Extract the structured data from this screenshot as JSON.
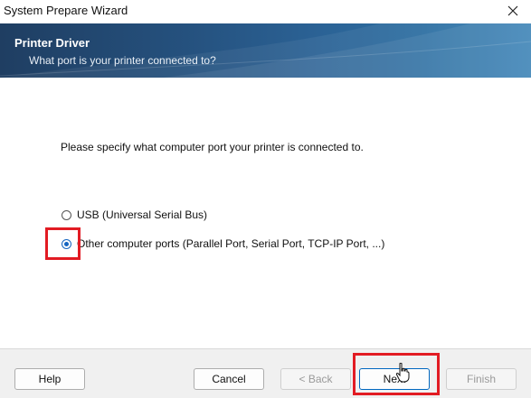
{
  "window": {
    "title": "System Prepare Wizard",
    "close_icon": "close-icon"
  },
  "banner": {
    "heading": "Printer Driver",
    "subheading": "What port is your printer connected to?",
    "colors": {
      "dark": "#1f3e62",
      "light": "#3a82b6"
    }
  },
  "content": {
    "instruction": "Please specify what computer port your printer is connected to.",
    "options": [
      {
        "label": "USB (Universal Serial Bus)",
        "selected": false
      },
      {
        "label": "Other computer ports (Parallel Port, Serial Port, TCP-IP Port, ...)",
        "selected": true
      }
    ]
  },
  "buttons": {
    "help": "Help",
    "cancel": "Cancel",
    "back": "< Back",
    "next": "Next",
    "finish": "Finish"
  },
  "highlight_color": "#e21b23"
}
